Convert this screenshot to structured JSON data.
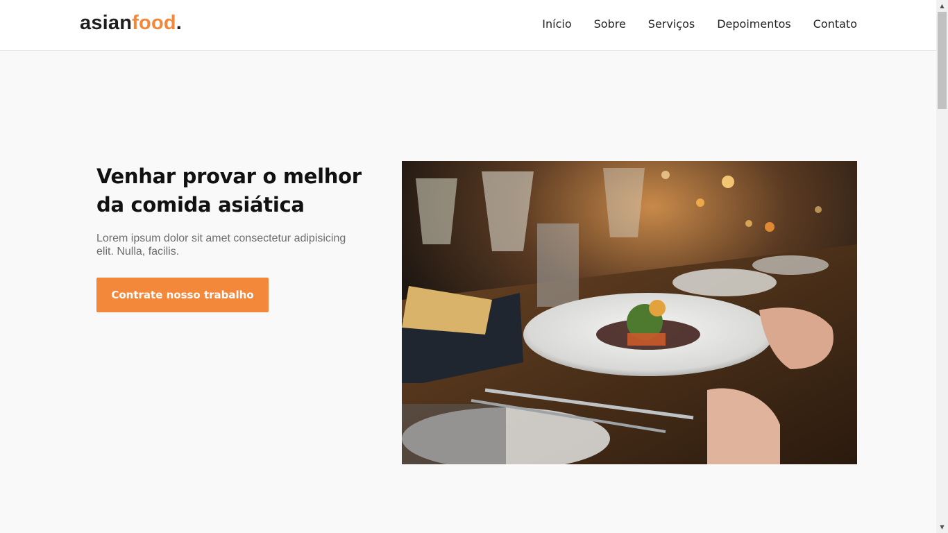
{
  "header": {
    "logo": {
      "part1": "asian",
      "part2": "food",
      "dot": "."
    },
    "nav": [
      "Início",
      "Sobre",
      "Serviços",
      "Depoimentos",
      "Contato"
    ]
  },
  "hero": {
    "title": "Venhar provar o melhor da comida asiática",
    "description": "Lorem ipsum dolor sit amet consectetur adipisicing elit. Nulla, facilis.",
    "cta_label": "Contrate nosso trabalho"
  },
  "colors": {
    "accent": "#f4883a",
    "background": "#f9f9f9",
    "text_dark": "#111111",
    "text_muted": "#6d6d6d"
  },
  "scrollbar": {
    "up_arrow": "▲",
    "down_arrow": "▼"
  }
}
